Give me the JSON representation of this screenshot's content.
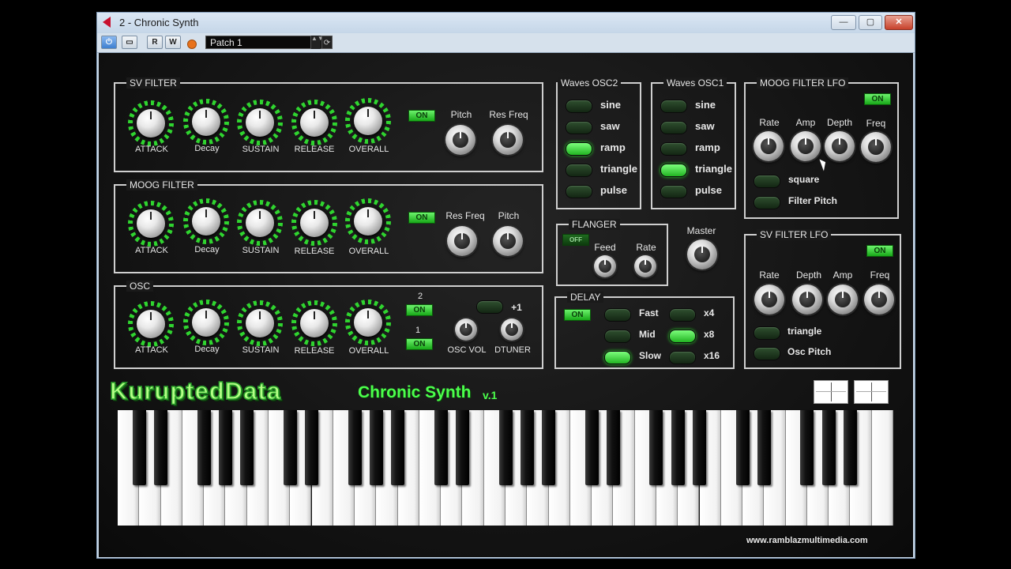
{
  "window": {
    "title": "2 - Chronic Synth",
    "minimize": "—",
    "maximize": "▢",
    "close": "✕"
  },
  "toolbar": {
    "read": "R",
    "write": "W",
    "patch": "Patch   1",
    "spin": "▲▼",
    "sync": "⟳"
  },
  "sv_filter": {
    "title": "SV FILTER",
    "knobs": [
      "ATTACK",
      "Decay",
      "SUSTAIN",
      "RELEASE",
      "OVERALL"
    ],
    "on": "ON",
    "pitch": "Pitch",
    "res_freq": "Res Freq"
  },
  "moog_filter": {
    "title": "MOOG FILTER",
    "knobs": [
      "ATTACK",
      "Decay",
      "SUSTAIN",
      "RELEASE",
      "OVERALL"
    ],
    "on": "ON",
    "res_freq": "Res Freq",
    "pitch": "Pitch"
  },
  "osc": {
    "title": "OSC",
    "knobs": [
      "ATTACK",
      "Decay",
      "SUSTAIN",
      "RELEASE",
      "OVERALL"
    ],
    "sel2": "2",
    "sel1": "1",
    "on": "ON",
    "plus1": "+1",
    "osc_vol": "OSC VOL",
    "dtuner": "DTUNER"
  },
  "waves_osc2": {
    "title": "Waves OSC2",
    "items": [
      "sine",
      "saw",
      "ramp",
      "triangle",
      "pulse"
    ],
    "selected": "ramp"
  },
  "waves_osc1": {
    "title": "Waves OSC1",
    "items": [
      "sine",
      "saw",
      "ramp",
      "triangle",
      "pulse"
    ],
    "selected": "triangle"
  },
  "moog_lfo": {
    "title": "MOOG FILTER LFO",
    "on": "ON",
    "knobs": [
      "Rate",
      "Amp",
      "Depth",
      "Freq"
    ],
    "opt1": "square",
    "opt2": "Filter Pitch"
  },
  "sv_lfo": {
    "title": "SV FILTER LFO",
    "on": "ON",
    "knobs": [
      "Rate",
      "Depth",
      "Amp",
      "Freq"
    ],
    "opt1": "triangle",
    "opt2": "Osc Pitch"
  },
  "flanger": {
    "title": "FLANGER",
    "off": "OFF",
    "feed": "Feed",
    "rate": "Rate"
  },
  "master": {
    "label": "Master"
  },
  "delay": {
    "title": "DELAY",
    "on": "ON",
    "speeds": [
      "Fast",
      "Mid",
      "Slow"
    ],
    "mults": [
      "x4",
      "x8",
      "x16"
    ],
    "selected_speed": "Slow",
    "selected_mult": "x8"
  },
  "brand": {
    "name": "KuruptedData",
    "product": "Chronic Synth",
    "version": "v.1",
    "website": "www.ramblazmultimedia.com"
  },
  "colors": {
    "accent_green": "#2fd42f",
    "panel_border": "#cfcfcf",
    "background": "#141414"
  }
}
